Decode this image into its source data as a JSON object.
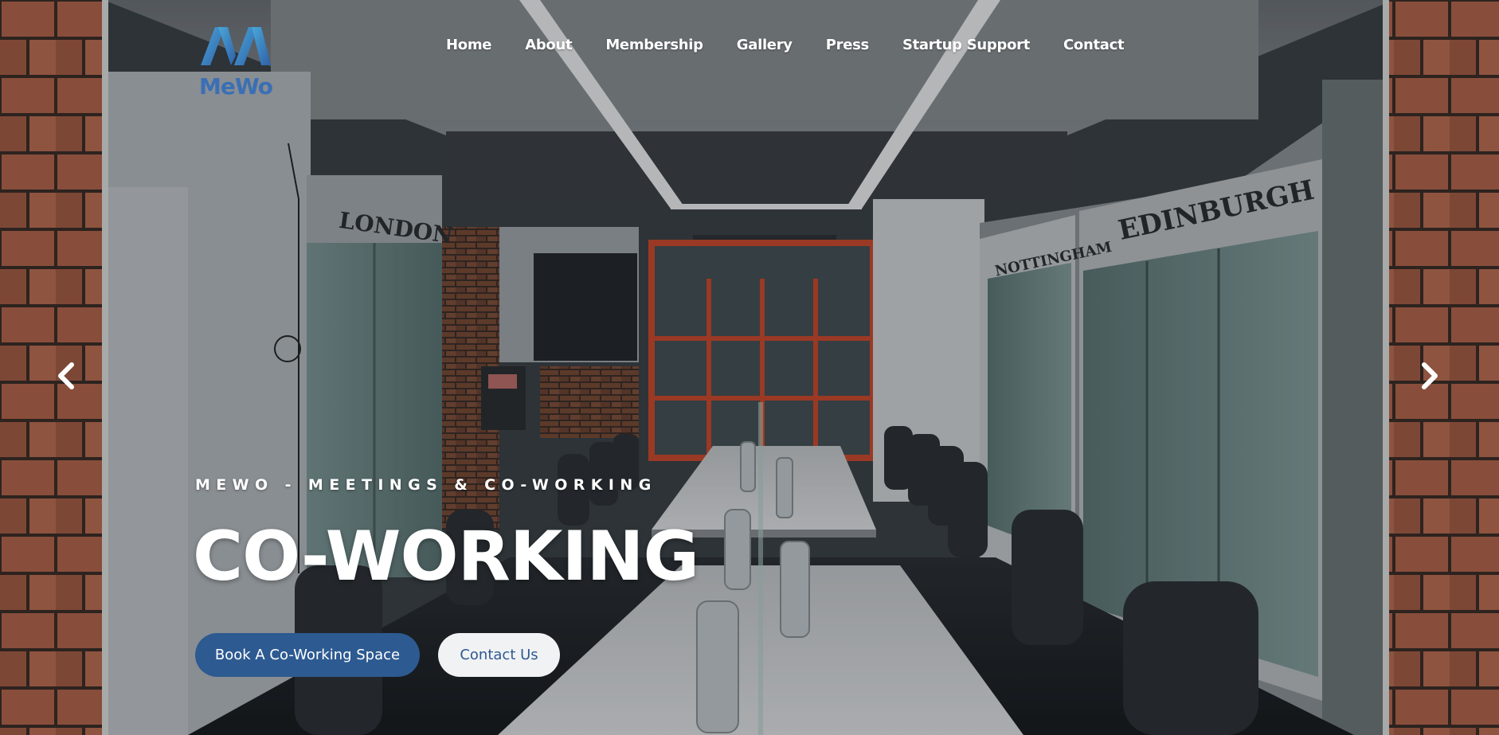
{
  "brand": {
    "logo_text": "MeWo",
    "logo_icon": "mewo-logo-icon",
    "accent": "#2d5a91",
    "logo_gradient": [
      "#4aa8d8",
      "#2f5fa8"
    ]
  },
  "nav": {
    "items": [
      {
        "label": "Home"
      },
      {
        "label": "About"
      },
      {
        "label": "Membership"
      },
      {
        "label": "Gallery"
      },
      {
        "label": "Press"
      },
      {
        "label": "Startup Support"
      },
      {
        "label": "Contact"
      }
    ]
  },
  "slider": {
    "prev_icon": "chevron-left-icon",
    "next_icon": "chevron-right-icon"
  },
  "hero": {
    "tagline": "MEWO - MEETINGS & CO-WORKING",
    "headline": "CO-WORKING",
    "primary_button": "Book A Co-Working Space",
    "secondary_button": "Contact Us"
  },
  "scene": {
    "room_signs": [
      "LONDON",
      "NOTTINGHAM",
      "EDINBURGH"
    ]
  }
}
